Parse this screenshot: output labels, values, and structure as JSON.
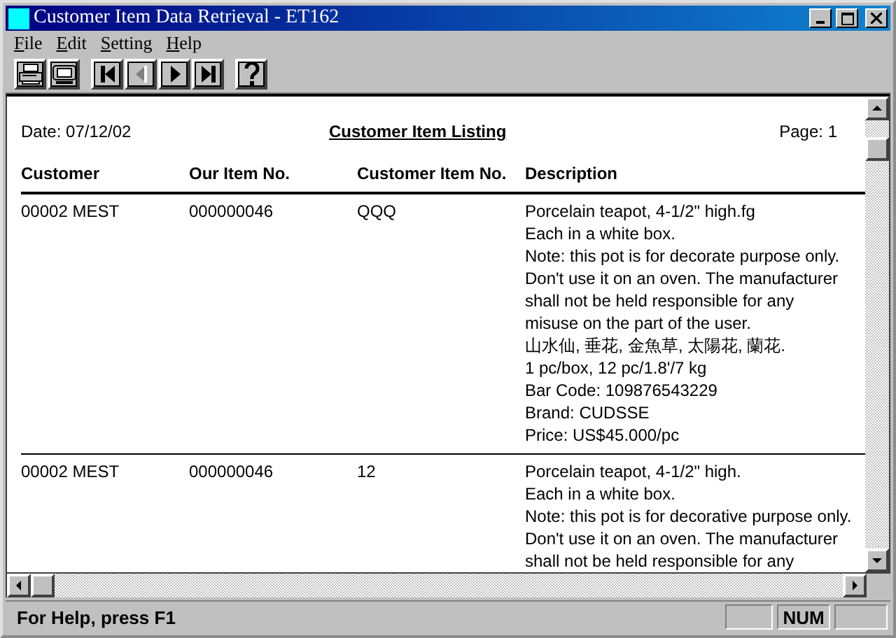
{
  "window": {
    "title": "Customer Item Data Retrieval - ET162"
  },
  "menu": [
    "File",
    "Edit",
    "Setting",
    "Help"
  ],
  "toolbar": [
    {
      "kind": "print",
      "disabled": false
    },
    {
      "kind": "preview",
      "disabled": false
    },
    {
      "kind": "first",
      "disabled": false
    },
    {
      "kind": "previous",
      "disabled": true
    },
    {
      "kind": "next",
      "disabled": false
    },
    {
      "kind": "last",
      "disabled": false
    },
    {
      "kind": "help",
      "disabled": false
    }
  ],
  "report": {
    "date": "Date: 07/12/02",
    "title": "Customer Item Listing",
    "page": "Page: 1",
    "columns": [
      "Customer",
      "Our Item No.",
      "Customer Item No.",
      "Description"
    ],
    "rows": [
      {
        "customer": "00002 MEST",
        "our_item_no": "000000046",
        "customer_item_no": "QQQ",
        "description": [
          "Porcelain teapot, 4-1/2\" high.fg",
          "Each in a white box.",
          "Note: this pot is for decorate purpose only.",
          "Don't use it on an oven. The manufacturer",
          "shall not be held responsible for any",
          "misuse on the part of the user.",
          "山水仙, 垂花, 金魚草, 太陽花, 蘭花.",
          "1 pc/box, 12 pc/1.8'/7 kg",
          "Bar Code: 109876543229",
          "Brand: CUDSSE",
          "Price: US$45.000/pc"
        ]
      },
      {
        "customer": "00002 MEST",
        "our_item_no": "000000046",
        "customer_item_no": "12",
        "description": [
          "Porcelain teapot, 4-1/2\" high.",
          "Each in a white box.",
          "Note: this pot is for decorative purpose only.",
          "Don't use it on an oven. The manufacturer",
          "shall not be held responsible for any"
        ]
      }
    ]
  },
  "status_bar": {
    "message": "For Help, press F1",
    "panes": [
      "NUM"
    ]
  }
}
